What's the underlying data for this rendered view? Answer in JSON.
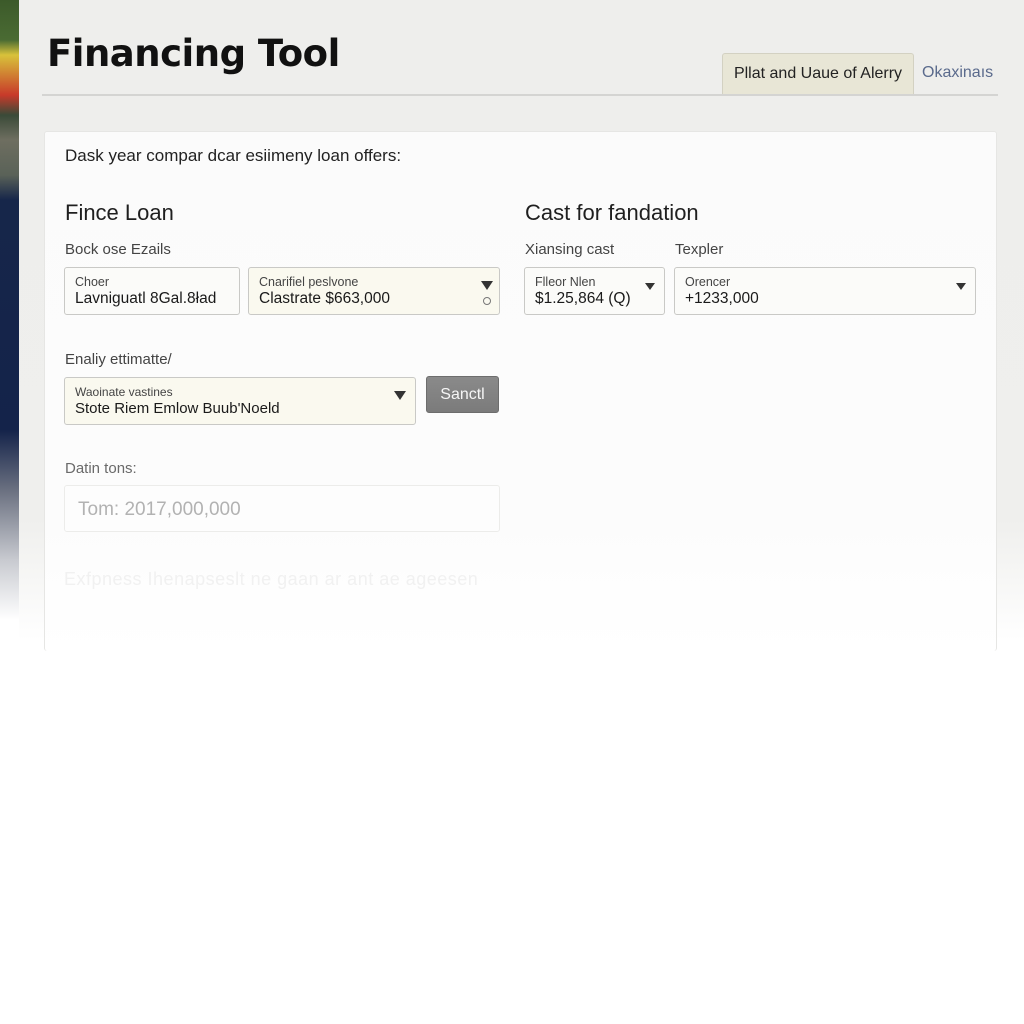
{
  "header": {
    "title": "Financing Tool",
    "tabs": [
      {
        "label": "Pllat and Uaue of Alerry",
        "active": true
      },
      {
        "label": "Okaxinaıs",
        "active": false
      }
    ]
  },
  "card": {
    "intro": "Dask year compar dcar esiimeny loan offers:",
    "left_section": {
      "title": "Fince Loan",
      "field_label": "Bock ose Ezails",
      "fields": [
        {
          "small_label": "Choer",
          "value": "Lavniguatl 8Gal.8ład",
          "type": "input"
        },
        {
          "small_label": "Cnarifiel peslvone",
          "value": "Clastrate $663,000",
          "type": "select"
        }
      ]
    },
    "right_section": {
      "title": "Cast for fandation",
      "fields": [
        {
          "label": "Xiansing cast",
          "small_label": "Flleor Nlen",
          "value": "$1.25,864 (Q)",
          "type": "select"
        },
        {
          "label": "Texpler",
          "small_label": "Orencer",
          "value": "+1233,000",
          "type": "select"
        }
      ]
    },
    "estimate": {
      "label": "Enaliy ettimatte/",
      "select": {
        "small_label": "Waoinate vastines",
        "value": "Stote Riem Emlow Buub'Noeld"
      },
      "button_label": "Sanctl"
    },
    "datin": {
      "label": "Datin tons:",
      "placeholder": "Tom: 2017,000,000"
    },
    "faded_text": "Exfpness Ihenapseslt ne  gaan ar ant ae ageesen"
  },
  "colors": {
    "tab_active_bg": "#e8e6d6",
    "button_bg": "#7f7f7f",
    "link_color": "#5a6a8c"
  }
}
